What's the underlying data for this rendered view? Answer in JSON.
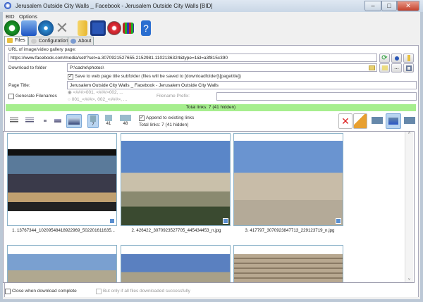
{
  "window": {
    "title": "Jerusalem Outside City Walls _ Facebook - Jerusalem Outside City Walls [BID]",
    "min": "–",
    "max": "□",
    "close": "✕"
  },
  "menu": [
    "BID",
    "Options"
  ],
  "toolbar": [
    {
      "icon": "refresh-icon"
    },
    {
      "icon": "download-icon"
    },
    {
      "icon": "help-bubble-icon"
    },
    {
      "icon": "cancel-icon"
    },
    {
      "icon": "folder-icon"
    },
    {
      "icon": "save-icon"
    },
    {
      "icon": "settings-icon"
    },
    {
      "icon": "film-icon"
    },
    {
      "icon": "help-book-icon"
    }
  ],
  "tabs": [
    {
      "label": "Files"
    },
    {
      "label": "Configuration"
    },
    {
      "label": "About"
    }
  ],
  "form": {
    "url_label": "URL of image/video gallery page:",
    "url_value": "https://www.facebook.com/media/set/?set=a.3070921527655.2152981.1102136324&type=1&l=a3f815c390",
    "folder_label": "Download to folder",
    "folder_value": "P:\\cache\\photos\\",
    "subfolder_label": "Save to web page title subfolder (files will be saved to [downloadfolder]\\[pagetitle])",
    "page_title_label": "Page Title:",
    "page_title_value": "Jerusalem Outside City Walls _ Facebook - Jerusalem Outside City Walls",
    "generate_label": "Generate Filenames",
    "radio1": "<###>001, <###>002, ...",
    "radio2": "001_<###>, 002_<###>, ...",
    "prefix_label": "Filename Prefix:",
    "prefix_value": "",
    "more_button": "..."
  },
  "status": {
    "total": "Total links: 7 (41 hidden)"
  },
  "filters": {
    "count_selected": "7",
    "count_b": "41",
    "count_c": "48",
    "append_label": "Append to existing links",
    "total": "Total links: 7 (41 hidden)"
  },
  "thumbnails": [
    {
      "caption": "1. 13767344_10209548418922969_502201611635..."
    },
    {
      "caption": "2. 426422_3070923527705_445434453_n.jpg"
    },
    {
      "caption": "3. 417797_3070923847713_229123719_n.jpg"
    }
  ],
  "footer": {
    "close_label": "Close when download complete",
    "only_label": "But only if all files downloaded successfully"
  },
  "colors": {
    "status_green": "#a6ee8e",
    "accent": "#2a56c6"
  }
}
